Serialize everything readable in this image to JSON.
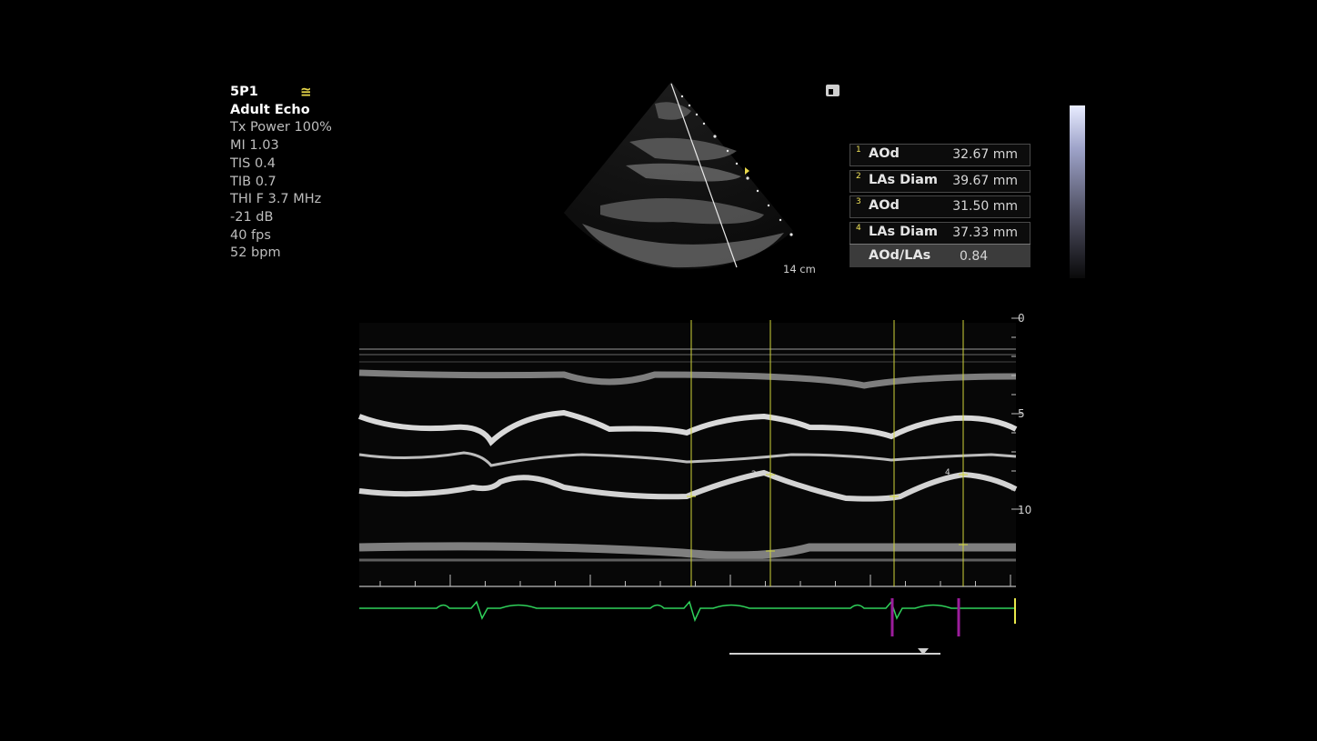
{
  "params": {
    "probe": "5P1",
    "preset": "Adult Echo",
    "tx_power": "Tx Power 100%",
    "mi": "MI 1.03",
    "tis": "TIS 0.4",
    "tib": "TIB 0.7",
    "thi": "THI F 3.7 MHz",
    "gain": "-21 dB",
    "fps": "40 fps",
    "bpm": "52 bpm",
    "probe_icon": "wave-equals-icon"
  },
  "image": {
    "depth": "14 cm",
    "freeze_icon": "freeze-icon"
  },
  "measurements": [
    {
      "index": "1",
      "label": "AOd",
      "value": "32.67 mm"
    },
    {
      "index": "2",
      "label": "LAs Diam",
      "value": "39.67 mm"
    },
    {
      "index": "3",
      "label": "AOd",
      "value": "31.50 mm"
    },
    {
      "index": "4",
      "label": "LAs Diam",
      "value": "37.33 mm"
    }
  ],
  "ratio": {
    "label": "AOd/LAs",
    "value": "0.84"
  },
  "mmode": {
    "depth_scale": [
      "0",
      "5",
      "10"
    ],
    "marker_labels": [
      "2",
      "4"
    ]
  },
  "colors": {
    "accent_yellow": "#e8d84a",
    "ecg_green": "#2fd15a",
    "marker_purple": "#9b1d9b",
    "caliper_yellow": "#cfd33a"
  }
}
